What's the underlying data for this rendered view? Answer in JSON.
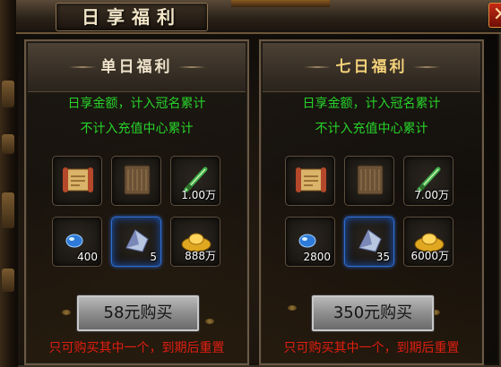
{
  "window": {
    "title": "日享福利",
    "close_label": "✕"
  },
  "panels": [
    {
      "title": "单日福利",
      "desc_line1": "日享金额，计入冠名累计",
      "desc_line2": "不计入充值中心累计",
      "items": [
        {
          "icon": "scroll-icon",
          "qty": ""
        },
        {
          "icon": "book-icon",
          "qty": ""
        },
        {
          "icon": "jade-sword-icon",
          "qty": "1.00万"
        },
        {
          "icon": "blue-gem-icon",
          "qty": "400"
        },
        {
          "icon": "silver-ore-icon",
          "qty": "5",
          "selected": true
        },
        {
          "icon": "gold-ingot-icon",
          "qty": "888万"
        }
      ],
      "buy_label": "58元购买",
      "note": "只可购买其中一个，到期后重置"
    },
    {
      "title": "七日福利",
      "desc_line1": "日享金额，计入冠名累计",
      "desc_line2": "不计入充值中心累计",
      "items": [
        {
          "icon": "scroll-icon",
          "qty": ""
        },
        {
          "icon": "book-icon",
          "qty": ""
        },
        {
          "icon": "jade-sword-icon",
          "qty": "7.00万"
        },
        {
          "icon": "blue-gem-icon",
          "qty": "2800"
        },
        {
          "icon": "silver-ore-icon",
          "qty": "35",
          "selected": true
        },
        {
          "icon": "gold-ingot-icon",
          "qty": "6000万"
        }
      ],
      "buy_label": "350元购买",
      "note": "只可购买其中一个，到期后重置"
    }
  ],
  "colors": {
    "desc_green": "#27d32a",
    "note_red": "#e01e10",
    "title_gold": "#f5d27a"
  }
}
